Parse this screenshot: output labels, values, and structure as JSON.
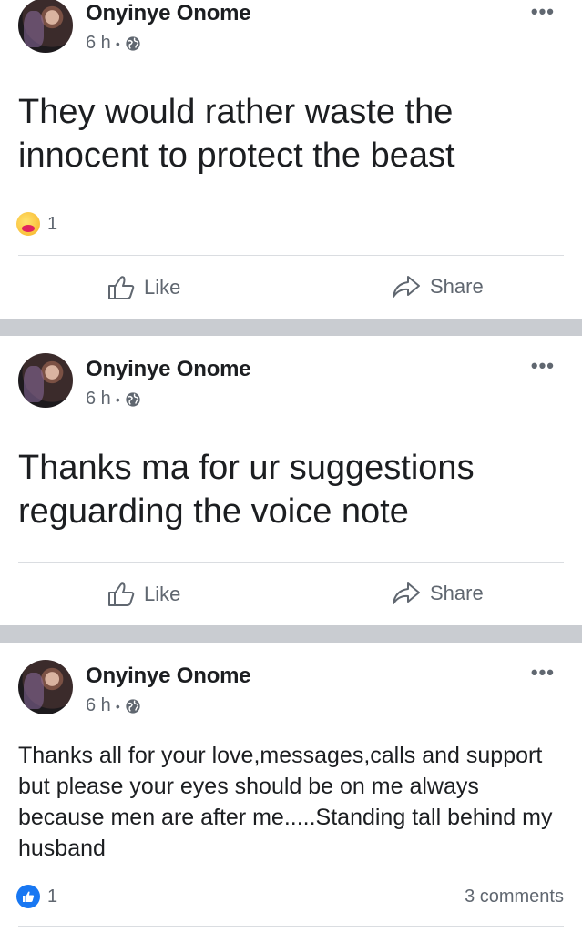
{
  "posts": [
    {
      "author": "Onyinye Onome",
      "time": "6 h",
      "dot": "•",
      "text": "They would rather waste the innocent to protect the beast",
      "reaction_count": "1",
      "reaction_type": "hug-emoji",
      "like_label": "Like",
      "share_label": "Share"
    },
    {
      "author": "Onyinye Onome",
      "time": "6 h",
      "dot": "•",
      "text": "Thanks ma for ur suggestions reguarding the voice note",
      "like_label": "Like",
      "share_label": "Share"
    },
    {
      "author": "Onyinye Onome",
      "time": "6 h",
      "dot": "•",
      "text": "Thanks all for your love,messages,calls and support but please your eyes should be on me always because men are after me.....Standing tall behind my husband",
      "reaction_count": "1",
      "reaction_type": "like-icon",
      "comments": "3 comments"
    }
  ],
  "colors": {
    "separator": "#c9ccd1",
    "secondary_text": "#606770",
    "like_blue": "#1877f2"
  }
}
